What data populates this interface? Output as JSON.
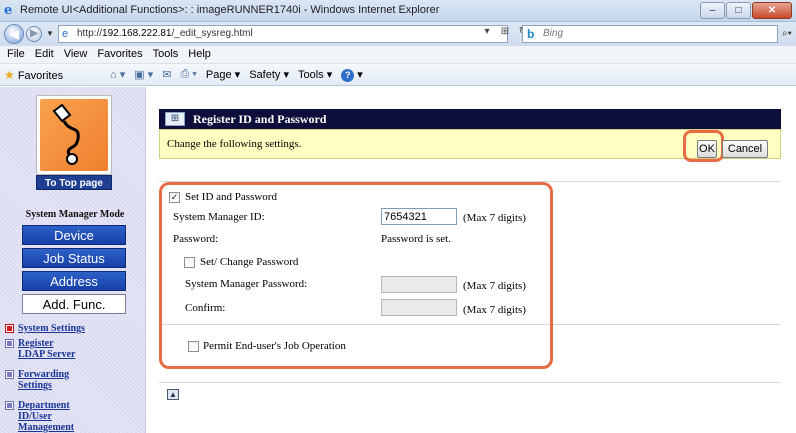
{
  "window": {
    "title": "Remote UI<Additional Functions>: : imageRUNNER1740i - Windows Internet Explorer",
    "buttons": {
      "minimize": "–",
      "maximize": "□",
      "close": "✕"
    }
  },
  "addressbar": {
    "url_prefix": "http://",
    "url_host": "192.168.222.81",
    "url_path": "/_edit_sysreg.html",
    "search_placeholder": "Bing"
  },
  "menu": [
    "File",
    "Edit",
    "View",
    "Favorites",
    "Tools",
    "Help"
  ],
  "favbar": {
    "favorites_label": "Favorites",
    "page_label": "Page ▾",
    "safety_label": "Safety ▾",
    "tools_label": "Tools ▾"
  },
  "sidebar": {
    "to_top_label": "To Top page",
    "mode_title": "System Manager Mode",
    "mode_buttons": [
      "Device",
      "Job Status",
      "Address",
      "Add. Func."
    ],
    "links": [
      "System Settings",
      "Register LDAP Server",
      "Forwarding Settings",
      "Department ID/User Management"
    ]
  },
  "main": {
    "header_title": "Register ID and Password",
    "notice_text": "Change the following settings.",
    "ok_label": "OK",
    "cancel_label": "Cancel",
    "set_id_label": "Set ID and Password",
    "set_id_checked": true,
    "system_manager_id_label": "System Manager ID:",
    "system_manager_id_value": "7654321",
    "max_digits_note": "(Max 7 digits)",
    "password_label": "Password:",
    "password_status": "Password is set.",
    "set_change_password_label": "Set/ Change Password",
    "set_change_password_checked": false,
    "system_manager_password_label": "System Manager Password:",
    "confirm_label": "Confirm:",
    "permit_label": "Permit End-user's Job Operation",
    "permit_checked": false
  },
  "colors": {
    "highlight": "#e76b45",
    "header_bg": "#0e0e3d",
    "notice_bg": "#ffffc2",
    "nav_button": "#1640a8"
  }
}
